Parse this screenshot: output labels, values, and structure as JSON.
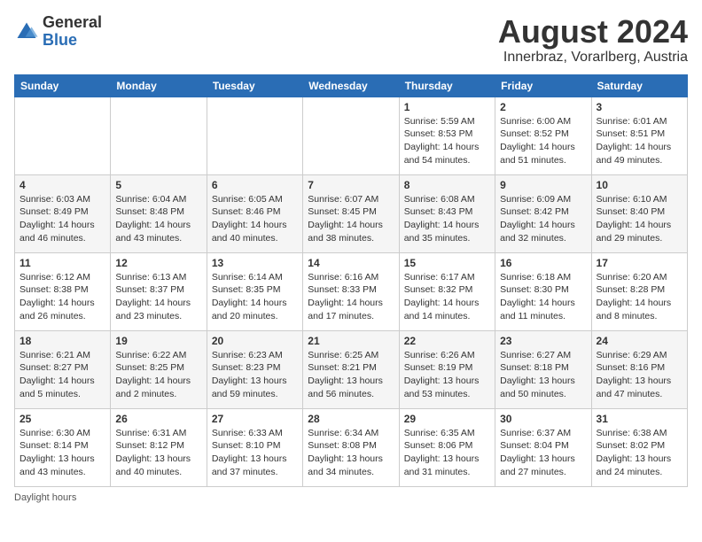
{
  "header": {
    "logo_general": "General",
    "logo_blue": "Blue",
    "month_year": "August 2024",
    "location": "Innerbraz, Vorarlberg, Austria"
  },
  "days_of_week": [
    "Sunday",
    "Monday",
    "Tuesday",
    "Wednesday",
    "Thursday",
    "Friday",
    "Saturday"
  ],
  "weeks": [
    [
      {
        "day": "",
        "info": ""
      },
      {
        "day": "",
        "info": ""
      },
      {
        "day": "",
        "info": ""
      },
      {
        "day": "",
        "info": ""
      },
      {
        "day": "1",
        "info": "Sunrise: 5:59 AM\nSunset: 8:53 PM\nDaylight: 14 hours\nand 54 minutes."
      },
      {
        "day": "2",
        "info": "Sunrise: 6:00 AM\nSunset: 8:52 PM\nDaylight: 14 hours\nand 51 minutes."
      },
      {
        "day": "3",
        "info": "Sunrise: 6:01 AM\nSunset: 8:51 PM\nDaylight: 14 hours\nand 49 minutes."
      }
    ],
    [
      {
        "day": "4",
        "info": "Sunrise: 6:03 AM\nSunset: 8:49 PM\nDaylight: 14 hours\nand 46 minutes."
      },
      {
        "day": "5",
        "info": "Sunrise: 6:04 AM\nSunset: 8:48 PM\nDaylight: 14 hours\nand 43 minutes."
      },
      {
        "day": "6",
        "info": "Sunrise: 6:05 AM\nSunset: 8:46 PM\nDaylight: 14 hours\nand 40 minutes."
      },
      {
        "day": "7",
        "info": "Sunrise: 6:07 AM\nSunset: 8:45 PM\nDaylight: 14 hours\nand 38 minutes."
      },
      {
        "day": "8",
        "info": "Sunrise: 6:08 AM\nSunset: 8:43 PM\nDaylight: 14 hours\nand 35 minutes."
      },
      {
        "day": "9",
        "info": "Sunrise: 6:09 AM\nSunset: 8:42 PM\nDaylight: 14 hours\nand 32 minutes."
      },
      {
        "day": "10",
        "info": "Sunrise: 6:10 AM\nSunset: 8:40 PM\nDaylight: 14 hours\nand 29 minutes."
      }
    ],
    [
      {
        "day": "11",
        "info": "Sunrise: 6:12 AM\nSunset: 8:38 PM\nDaylight: 14 hours\nand 26 minutes."
      },
      {
        "day": "12",
        "info": "Sunrise: 6:13 AM\nSunset: 8:37 PM\nDaylight: 14 hours\nand 23 minutes."
      },
      {
        "day": "13",
        "info": "Sunrise: 6:14 AM\nSunset: 8:35 PM\nDaylight: 14 hours\nand 20 minutes."
      },
      {
        "day": "14",
        "info": "Sunrise: 6:16 AM\nSunset: 8:33 PM\nDaylight: 14 hours\nand 17 minutes."
      },
      {
        "day": "15",
        "info": "Sunrise: 6:17 AM\nSunset: 8:32 PM\nDaylight: 14 hours\nand 14 minutes."
      },
      {
        "day": "16",
        "info": "Sunrise: 6:18 AM\nSunset: 8:30 PM\nDaylight: 14 hours\nand 11 minutes."
      },
      {
        "day": "17",
        "info": "Sunrise: 6:20 AM\nSunset: 8:28 PM\nDaylight: 14 hours\nand 8 minutes."
      }
    ],
    [
      {
        "day": "18",
        "info": "Sunrise: 6:21 AM\nSunset: 8:27 PM\nDaylight: 14 hours\nand 5 minutes."
      },
      {
        "day": "19",
        "info": "Sunrise: 6:22 AM\nSunset: 8:25 PM\nDaylight: 14 hours\nand 2 minutes."
      },
      {
        "day": "20",
        "info": "Sunrise: 6:23 AM\nSunset: 8:23 PM\nDaylight: 13 hours\nand 59 minutes."
      },
      {
        "day": "21",
        "info": "Sunrise: 6:25 AM\nSunset: 8:21 PM\nDaylight: 13 hours\nand 56 minutes."
      },
      {
        "day": "22",
        "info": "Sunrise: 6:26 AM\nSunset: 8:19 PM\nDaylight: 13 hours\nand 53 minutes."
      },
      {
        "day": "23",
        "info": "Sunrise: 6:27 AM\nSunset: 8:18 PM\nDaylight: 13 hours\nand 50 minutes."
      },
      {
        "day": "24",
        "info": "Sunrise: 6:29 AM\nSunset: 8:16 PM\nDaylight: 13 hours\nand 47 minutes."
      }
    ],
    [
      {
        "day": "25",
        "info": "Sunrise: 6:30 AM\nSunset: 8:14 PM\nDaylight: 13 hours\nand 43 minutes."
      },
      {
        "day": "26",
        "info": "Sunrise: 6:31 AM\nSunset: 8:12 PM\nDaylight: 13 hours\nand 40 minutes."
      },
      {
        "day": "27",
        "info": "Sunrise: 6:33 AM\nSunset: 8:10 PM\nDaylight: 13 hours\nand 37 minutes."
      },
      {
        "day": "28",
        "info": "Sunrise: 6:34 AM\nSunset: 8:08 PM\nDaylight: 13 hours\nand 34 minutes."
      },
      {
        "day": "29",
        "info": "Sunrise: 6:35 AM\nSunset: 8:06 PM\nDaylight: 13 hours\nand 31 minutes."
      },
      {
        "day": "30",
        "info": "Sunrise: 6:37 AM\nSunset: 8:04 PM\nDaylight: 13 hours\nand 27 minutes."
      },
      {
        "day": "31",
        "info": "Sunrise: 6:38 AM\nSunset: 8:02 PM\nDaylight: 13 hours\nand 24 minutes."
      }
    ]
  ],
  "footer": {
    "note": "Daylight hours"
  }
}
